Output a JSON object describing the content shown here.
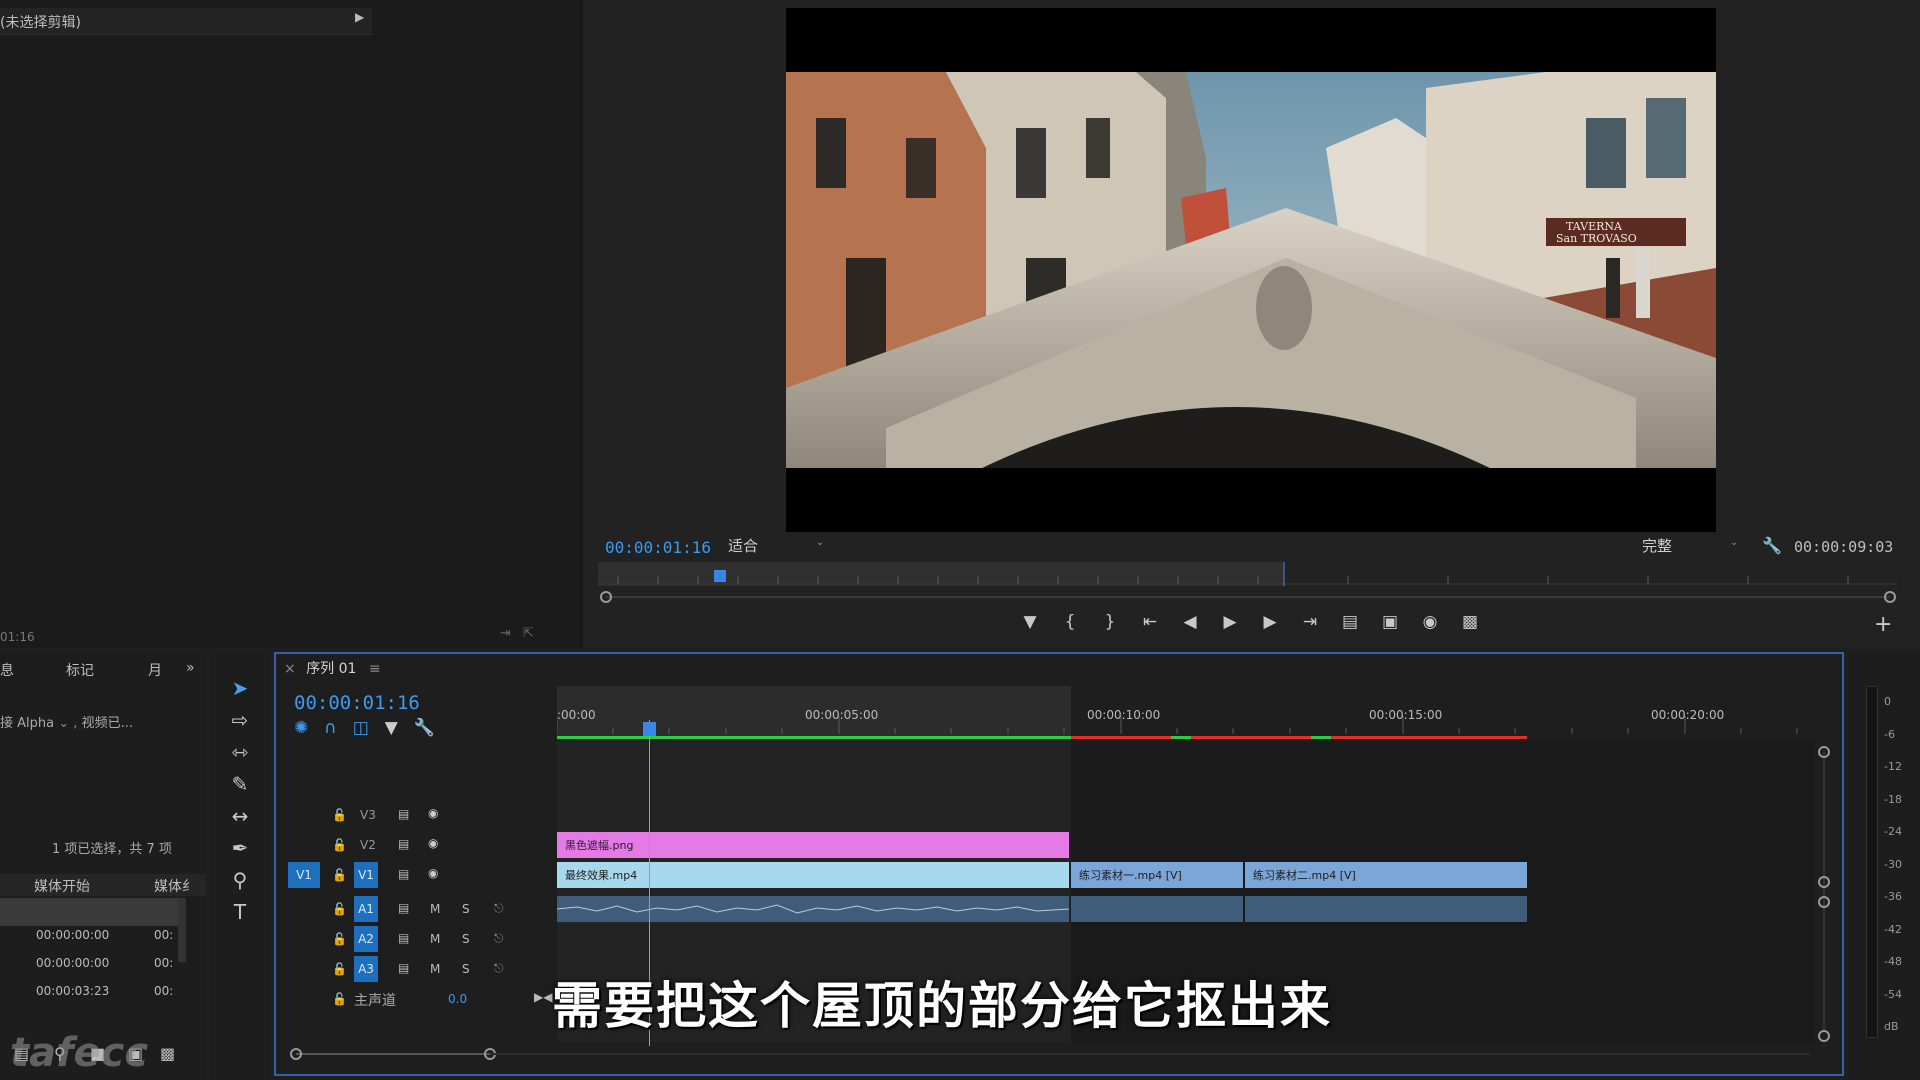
{
  "source_monitor": {
    "title": "(未选择剪辑)",
    "timecode": "01:16"
  },
  "program_monitor": {
    "timecode": "00:00:01:16",
    "fit_label": "适合",
    "quality_label": "完整",
    "duration": "00:00:09:03",
    "video_sign_1": "TAVERNA",
    "video_sign_2": "San TROVASO"
  },
  "project_panel": {
    "tabs": [
      "息",
      "标记",
      "月"
    ],
    "more": "»",
    "sub_label": "接 Alpha",
    "sub_label2": "视频已...",
    "count": "1 项已选择，共 7 项",
    "columns": [
      "媒体开始",
      "媒体纟"
    ],
    "rows": [
      {
        "start": "00:00:00:00",
        "end": "00:"
      },
      {
        "start": "00:00:00:00",
        "end": "00:"
      },
      {
        "start": "00:00:03:23",
        "end": "00:"
      }
    ]
  },
  "timeline": {
    "sequence_tab": "序列 01",
    "timecode": "00:00:01:16",
    "ruler_labels": [
      ":00:00",
      "00:00:05:00",
      "00:00:10:00",
      "00:00:15:00",
      "00:00:20:00"
    ],
    "tracks": {
      "v3": "V3",
      "v2": "V2",
      "v1": "V1",
      "v1_source": "V1",
      "a1": "A1",
      "a2": "A2",
      "a3": "A3",
      "master": "主声道",
      "master_value": "0.0"
    },
    "clips": {
      "v2_clip": "黑色遮幅.png",
      "v1_clip1": "最终效果.mp4",
      "v1_clip2": "练习素材一.mp4 [V]",
      "v1_clip3": "练习素材二.mp4 [V]"
    },
    "mute": "M",
    "solo": "S"
  },
  "meter": {
    "labels": [
      "0",
      "-6",
      "-12",
      "-18",
      "-24",
      "-30",
      "-36",
      "-42",
      "-48",
      "-54",
      "dB"
    ]
  },
  "subtitle": "需要把这个屋顶的部分给它抠出来",
  "watermark": "tafecc",
  "colors": {
    "accent": "#3a9bf0",
    "v2_clip": "#e47be4",
    "v1_clip": "#a6d8ee",
    "v1_clip_b": "#7aa6d8",
    "audio_clip": "#3f5c7a"
  }
}
